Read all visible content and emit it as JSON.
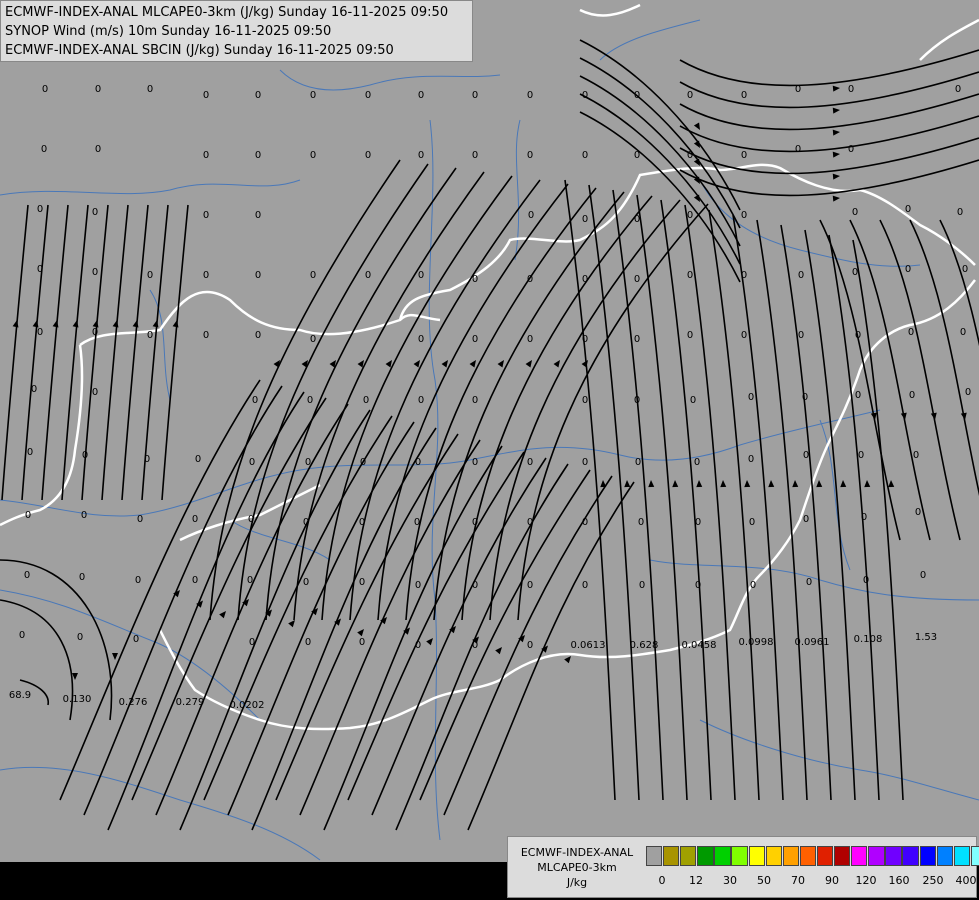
{
  "titles": [
    "ECMWF-INDEX-ANAL MLCAPE0-3km (J/kg) Sunday 16-11-2025 09:50",
    "SYNOP Wind (m/s) 10m Sunday 16-11-2025 09:50",
    "ECMWF-INDEX-ANAL SBCIN (J/kg) Sunday 16-11-2025 09:50"
  ],
  "legend": {
    "title_lines": [
      "ECMWF-INDEX-ANAL",
      "MLCAPE0-3km",
      "J/kg"
    ],
    "colors": [
      "#a0a0a0",
      "#a89400",
      "#a0a000",
      "#009a00",
      "#00d000",
      "#80ff00",
      "#ffff00",
      "#ffd000",
      "#ffa000",
      "#ff6000",
      "#e02000",
      "#b00000",
      "#ff00ff",
      "#b000ff",
      "#7000ff",
      "#4000ff",
      "#0000ff",
      "#0080ff",
      "#00e0ff",
      "#80ffff",
      "#ffffff"
    ],
    "ticks": [
      "0",
      "12",
      "30",
      "50",
      "70",
      "90",
      "120",
      "160",
      "250",
      "400"
    ]
  },
  "map_colors": {
    "background": "#a0a0a0",
    "rivers": "#4a78b8",
    "borders": "#ffffff",
    "streamlines": "#000000",
    "labels": "#000000"
  },
  "labels": [
    "0",
    "0",
    "0",
    "0",
    "0",
    "0",
    "0",
    "0",
    "0",
    "0",
    "0",
    "0",
    "0",
    "0",
    "0",
    "0",
    "0",
    "0",
    "0",
    "0",
    "0",
    "0",
    "0",
    "0",
    "0",
    "0",
    "0",
    "0",
    "0",
    "0",
    "0",
    "0",
    "0",
    "0",
    "0",
    "0",
    "0",
    "0",
    "0",
    "0",
    "0",
    "0",
    "0",
    "0",
    "0",
    "0",
    "0",
    "0",
    "0",
    "0",
    "0",
    "0",
    "0",
    "0",
    "0",
    "0",
    "0",
    "0",
    "0",
    "0",
    "0",
    "0",
    "0",
    "0",
    "0",
    "0",
    "0",
    "0",
    "0",
    "0",
    "0",
    "0",
    "0",
    "0",
    "0",
    "0",
    "0",
    "0",
    "0",
    "0",
    "0",
    "0",
    "0",
    "0",
    "0",
    "0",
    "0",
    "0",
    "0",
    "0",
    "0",
    "0",
    "0",
    "0",
    "0",
    "0",
    "0",
    "0",
    "0",
    "0",
    "0",
    "0",
    "0",
    "0",
    "0",
    "0",
    "0",
    "0",
    "0",
    "0",
    "0",
    "0",
    "0",
    "0",
    "0",
    "0",
    "0",
    "0",
    "0",
    "0",
    "0",
    "0",
    "0",
    "0",
    "0",
    "0",
    "0",
    "0",
    "0",
    "0",
    "0",
    "0",
    "0",
    "0",
    "0",
    "0",
    "0",
    "0",
    "0",
    "0",
    "0",
    "0",
    "0",
    "0",
    "0",
    "0",
    "0",
    "0",
    "0",
    "0",
    "0",
    "0",
    "0",
    "0",
    "0.0613",
    "0.628",
    "0.0458",
    "0.0998",
    "0.0961",
    "0.108",
    "1.53",
    "68.9",
    "0.130",
    "0.276",
    "0.279",
    "0.0202"
  ]
}
